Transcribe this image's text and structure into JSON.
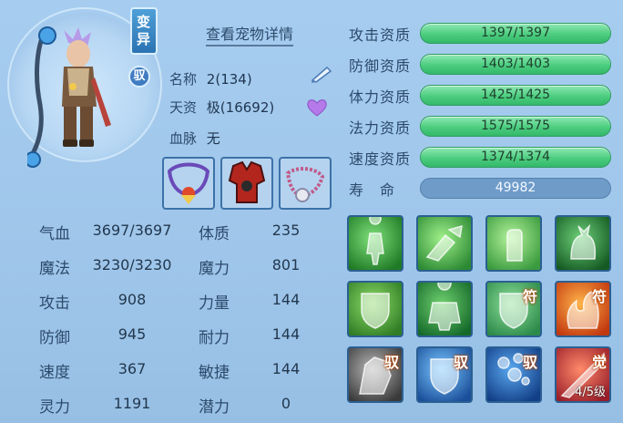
{
  "pet": {
    "variant_tag": "变异",
    "tame_tag": "驭",
    "details_link": "查看宠物详情",
    "name_label": "名称",
    "name_value": "2(134)",
    "talent_label": "天资",
    "talent_value": "极(16692)",
    "bloodline_label": "血脉",
    "bloodline_value": "无"
  },
  "stats_left": [
    {
      "label": "气血",
      "value": "3697/3697"
    },
    {
      "label": "魔法",
      "value": "3230/3230"
    },
    {
      "label": "攻击",
      "value": "908"
    },
    {
      "label": "防御",
      "value": "945"
    },
    {
      "label": "速度",
      "value": "367"
    },
    {
      "label": "灵力",
      "value": "1191"
    }
  ],
  "stats_right": [
    {
      "label": "体质",
      "value": "235"
    },
    {
      "label": "魔力",
      "value": "801"
    },
    {
      "label": "力量",
      "value": "144"
    },
    {
      "label": "耐力",
      "value": "144"
    },
    {
      "label": "敏捷",
      "value": "144"
    },
    {
      "label": "潜力",
      "value": "0"
    }
  ],
  "aptitudes": [
    {
      "label": "攻击资质",
      "value": "1397/1397"
    },
    {
      "label": "防御资质",
      "value": "1403/1403"
    },
    {
      "label": "体力资质",
      "value": "1425/1425"
    },
    {
      "label": "法力资质",
      "value": "1575/1575"
    },
    {
      "label": "速度资质",
      "value": "1374/1374"
    }
  ],
  "lifespan": {
    "label": "寿　命",
    "value": "49982"
  },
  "skills": [
    {
      "icon": "green-figure-skill-icon",
      "badge": "",
      "color1": "#7fe07a",
      "color2": "#1f7a25"
    },
    {
      "icon": "green-hand-strike-skill-icon",
      "badge": "",
      "color1": "#9ff08a",
      "color2": "#2c8a33"
    },
    {
      "icon": "green-palm-skill-icon",
      "badge": "",
      "color1": "#b4f39a",
      "color2": "#3a9a3e"
    },
    {
      "icon": "green-cat-skill-icon",
      "badge": "",
      "color1": "#6fd07a",
      "color2": "#145a22"
    },
    {
      "icon": "green-shield-emblem-skill-icon",
      "badge": "",
      "color1": "#8fdc6a",
      "color2": "#2f7d25"
    },
    {
      "icon": "green-muscle-skill-icon",
      "badge": "",
      "color1": "#6fd06f",
      "color2": "#156a2a"
    },
    {
      "icon": "green-shield-rune-skill-icon",
      "badge": "符",
      "color1": "#8fe09a",
      "color2": "#2c8a4a"
    },
    {
      "icon": "fire-rune-skill-icon",
      "badge": "符",
      "color1": "#ffb44a",
      "color2": "#c2380f"
    },
    {
      "icon": "gray-beast-skill-icon",
      "badge": "驭",
      "color1": "#b8b8b8",
      "color2": "#3a3a3a"
    },
    {
      "icon": "blue-shield-skill-icon",
      "badge": "驭",
      "color1": "#7ac8ff",
      "color2": "#1b4f9a"
    },
    {
      "icon": "blue-bubbles-skill-icon",
      "badge": "驭",
      "color1": "#5aa8f0",
      "color2": "#123f86"
    },
    {
      "icon": "red-awaken-skill-icon",
      "badge": "觉",
      "color1": "#ff8a6a",
      "color2": "#9a1f2a",
      "level": "4/5级"
    }
  ]
}
